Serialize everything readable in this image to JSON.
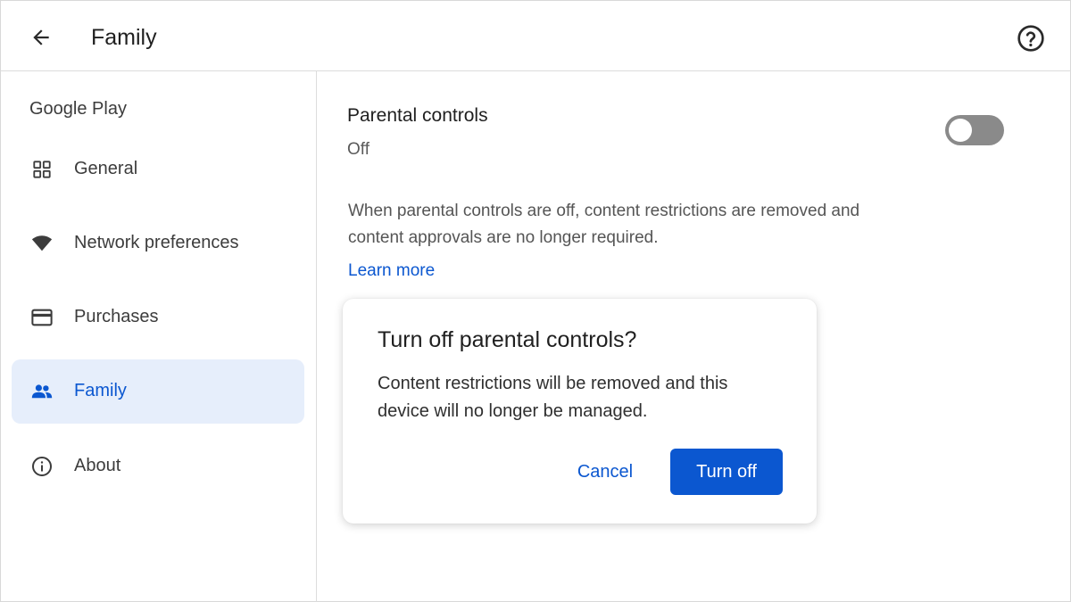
{
  "header": {
    "title": "Family",
    "back_icon": "arrow-back-icon",
    "help_icon": "help-circle-icon"
  },
  "sidebar": {
    "heading": "Google Play",
    "items": [
      {
        "label": "General",
        "icon": "grid-icon",
        "active": false
      },
      {
        "label": "Network preferences",
        "icon": "wifi-icon",
        "active": false
      },
      {
        "label": "Purchases",
        "icon": "credit-card-icon",
        "active": false
      },
      {
        "label": "Family",
        "icon": "people-icon",
        "active": true
      },
      {
        "label": "About",
        "icon": "info-icon",
        "active": false
      }
    ]
  },
  "main": {
    "parental_controls_title": "Parental controls",
    "parental_controls_state": "Off",
    "toggle_on": false,
    "description": "When parental controls are off, content restrictions are removed and content approvals are no longer required.",
    "learn_more": "Learn more"
  },
  "dialog": {
    "title": "Turn off parental controls?",
    "body": "Content restrictions will be removed and this device will no longer be managed.",
    "cancel_label": "Cancel",
    "confirm_label": "Turn off"
  },
  "colors": {
    "accent": "#0b57d0",
    "active_bg": "#e6eefb",
    "toggle_off": "#8a8a8a"
  }
}
